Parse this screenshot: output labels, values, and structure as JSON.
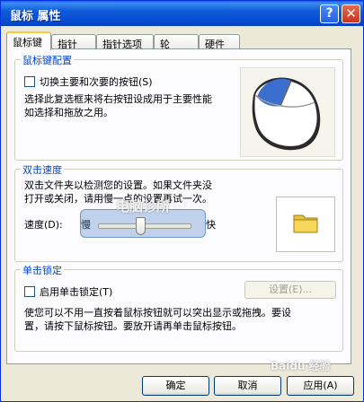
{
  "window": {
    "title": "鼠标 属性"
  },
  "titlebar": {
    "help_label": "?",
    "close_label": "✕"
  },
  "tabs": [
    {
      "label": "鼠标键",
      "active": true
    },
    {
      "label": "指针",
      "active": false
    },
    {
      "label": "指针选项",
      "active": false
    },
    {
      "label": "轮",
      "active": false
    },
    {
      "label": "硬件",
      "active": false
    }
  ],
  "button_config": {
    "title": "鼠标键配置",
    "switch_checkbox": {
      "label": "切换主要和次要的按钮(S)",
      "checked": false
    },
    "description_line1": "选择此复选框来将右按钮设成用于主要性能",
    "description_line2": "如选择和拖放之用。"
  },
  "double_click": {
    "title": "双击速度",
    "description_line1": "双击文件夹以检测您的设置。如果文件夹没",
    "description_line2": "打开或关闭，请用慢一点的设置再试一次。",
    "speed_label": "速度(D):",
    "slow_label": "慢",
    "fast_label": "快",
    "speed_level": 0.45
  },
  "click_lock": {
    "title": "单击锁定",
    "checkbox": {
      "label": "启用单击锁定(T)",
      "checked": false
    },
    "settings_button": "设置(E)...",
    "description_line1": "使您可以不用一直按着鼠标按钮就可以突出显示或拖拽。要设",
    "description_line2": "置，请按下鼠标按钮。要放开请再单击鼠标按钮。"
  },
  "footer": {
    "ok": "确定",
    "cancel": "取消",
    "apply": "应用(A)"
  },
  "watermarks": {
    "center": "电脑诊所",
    "corner": "Baidu 经验"
  },
  "colors": {
    "titlebar": "#0A5FE8",
    "group_title": "#0046D5",
    "dialog_bg": "#ECE9D8"
  }
}
